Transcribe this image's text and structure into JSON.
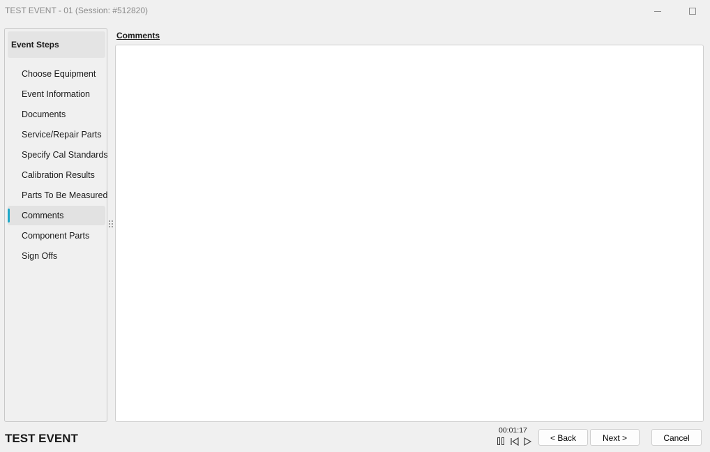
{
  "window": {
    "title": "TEST EVENT - 01 (Session: #512820)"
  },
  "sidebar": {
    "header": "Event Steps",
    "items": [
      {
        "label": "Choose Equipment"
      },
      {
        "label": "Event Information"
      },
      {
        "label": "Documents"
      },
      {
        "label": "Service/Repair Parts"
      },
      {
        "label": "Specify Cal Standards"
      },
      {
        "label": "Calibration Results"
      },
      {
        "label": "Parts To Be Measured"
      },
      {
        "label": "Comments",
        "active": true
      },
      {
        "label": "Component Parts"
      },
      {
        "label": "Sign Offs"
      }
    ]
  },
  "main": {
    "section_label": "Comments",
    "comments_value": ""
  },
  "footer": {
    "event_title": "TEST EVENT",
    "timer": "00:01:17",
    "back_label": "< Back",
    "next_label": "Next >",
    "cancel_label": "Cancel"
  },
  "colors": {
    "accent": "#1ea7c8",
    "background": "#f0f0f0",
    "panel_border": "#c8c8c8"
  },
  "icons": {
    "minimize": "minimize-icon",
    "maximize": "maximize-icon",
    "pause": "pause-icon",
    "previous": "skip-back-icon",
    "play": "play-icon",
    "splitter": "drag-handle-icon"
  }
}
